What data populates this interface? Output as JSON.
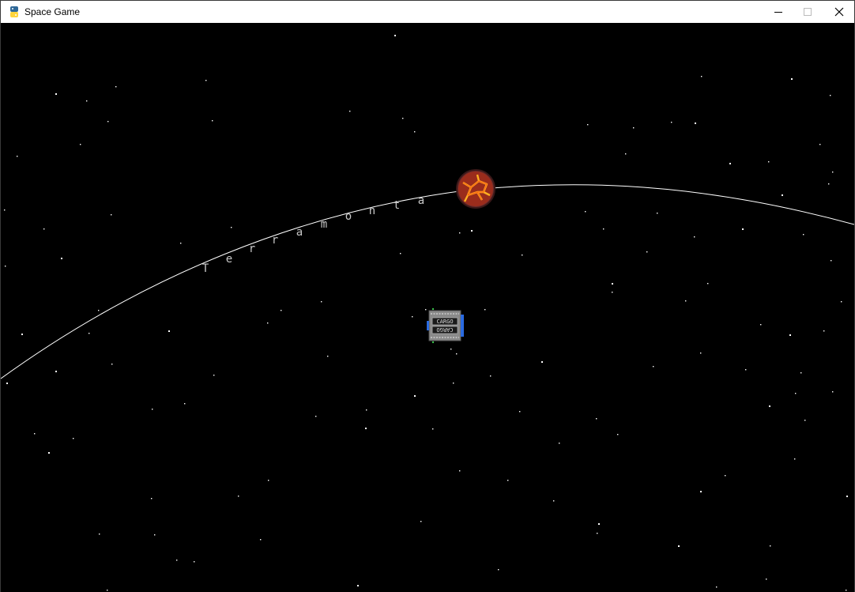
{
  "window": {
    "title": "Space Game",
    "icon": "python-snake-icon",
    "controls": [
      "minimize-icon",
      "maximize-icon",
      "close-icon"
    ]
  },
  "game": {
    "planet": {
      "name": "Terramonta",
      "name_letters": [
        "T",
        "e",
        "r",
        "r",
        "a",
        "m",
        "o",
        "n",
        "t",
        "a"
      ],
      "color_core": "#e8501a",
      "color_crust": "#6a2a2a",
      "color_lava": "#ffb020"
    },
    "orbit_color": "#ffffff",
    "ship": {
      "cargo_text": "CARGO",
      "hull_color": "#8a8a8a",
      "engine_color": "#2a6ae0"
    },
    "background_color": "#000000",
    "star_color": "#ffffff"
  }
}
